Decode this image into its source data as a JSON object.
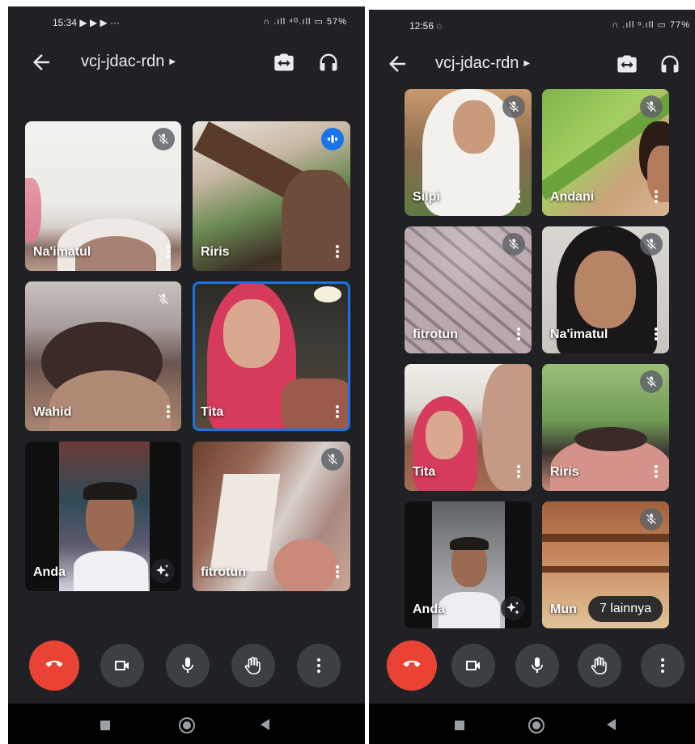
{
  "left_screen": {
    "status": {
      "time": "15:34",
      "notif_icons": "▶ ▶ ▶ ···",
      "right": "∩ .ıll ⁴ᴳ.ıll ▭ 57%"
    },
    "meeting_code": "vcj-jdac-rdn",
    "tiles": [
      {
        "name": "Na'imatul",
        "muted": true
      },
      {
        "name": "Riris",
        "muted": false,
        "speaking": true
      },
      {
        "name": "Wahid",
        "muted": true
      },
      {
        "name": "Tita",
        "muted": false,
        "active": true
      },
      {
        "name": "Anda",
        "self": true
      },
      {
        "name": "fitrotun",
        "muted": true
      }
    ]
  },
  "right_screen": {
    "status": {
      "time": "12:56",
      "notif_icons": "◌",
      "right": "∩ .ıll ᵒ.ıll ▭ 77%"
    },
    "meeting_code": "vcj-jdac-rdn",
    "tiles": [
      {
        "name": "Silpi",
        "muted": true
      },
      {
        "name": "Andani",
        "muted": true
      },
      {
        "name": "fitrotun",
        "muted": true
      },
      {
        "name": "Na'imatul",
        "muted": true
      },
      {
        "name": "Tita",
        "muted": false
      },
      {
        "name": "Riris",
        "muted": true
      },
      {
        "name": "Anda",
        "self": true
      },
      {
        "name": "Mun",
        "muted": true
      }
    ],
    "more_participants": "7 lainnya"
  },
  "controls": [
    "hangup-button",
    "camera-button",
    "mic-button",
    "raise-hand-button",
    "more-options-button"
  ],
  "colors": {
    "background": "#202124",
    "hangup": "#ea4335",
    "accent": "#1a73e8",
    "control": "#3c4043"
  }
}
